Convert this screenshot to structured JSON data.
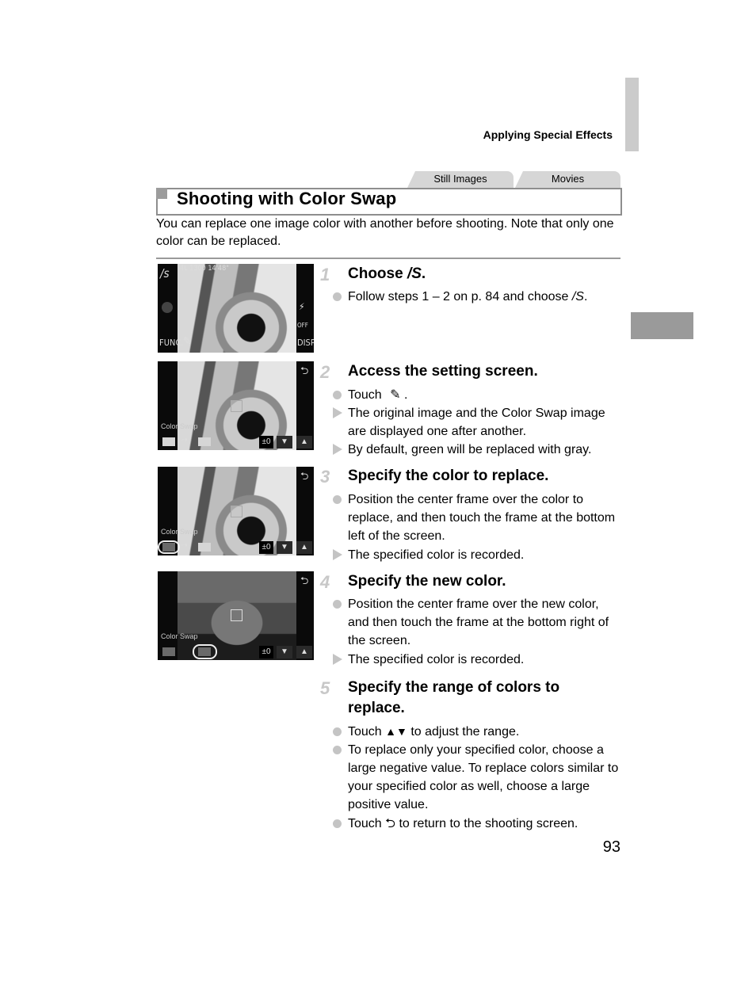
{
  "header": {
    "running_head": "Applying Special Effects",
    "tabs": [
      {
        "label": "Still Images"
      },
      {
        "label": "Movies"
      }
    ]
  },
  "section": {
    "title": "Shooting with Color Swap",
    "intro": "You can replace one image color with another before shooting. Note that only one color can be replaced."
  },
  "screens": [
    {
      "mode_icon": "/s",
      "status_text": "4L 1300 14'48\"",
      "left_buttons": [
        "●",
        "FUNC."
      ],
      "right_buttons": [
        "⚡",
        "OFF",
        "DISP."
      ],
      "eyedropper_icon": "eyedropper-icon"
    },
    {
      "label": "Color Swap",
      "range_value": "±0",
      "back_icon": "return-icon"
    },
    {
      "label": "Color Swap",
      "range_value": "±0",
      "highlight": "source-color-frame"
    },
    {
      "label": "Color Swap",
      "range_value": "±0",
      "highlight": "target-color-frame"
    }
  ],
  "steps": [
    {
      "number": "1",
      "title": "Choose",
      "title_icon": "/S",
      "bullets": [
        {
          "type": "action",
          "text": "Follow steps 1 – 2 on p. 84 and choose",
          "icon": "/S"
        }
      ]
    },
    {
      "number": "2",
      "title": "Access the setting screen.",
      "bullets": [
        {
          "type": "action",
          "text": "Touch",
          "icon": "eyedropper"
        },
        {
          "type": "result",
          "text": "The original image and the Color Swap image are displayed one after another."
        },
        {
          "type": "result",
          "text": "By default, green will be replaced with gray."
        }
      ]
    },
    {
      "number": "3",
      "title": "Specify the color to replace.",
      "bullets": [
        {
          "type": "action",
          "text": "Position the center frame over the color to replace, and then touch the frame at the bottom left of the screen."
        },
        {
          "type": "result",
          "text": "The specified color is recorded."
        }
      ]
    },
    {
      "number": "4",
      "title": "Specify the new color.",
      "bullets": [
        {
          "type": "action",
          "text": "Position the center frame over the new color, and then touch the frame at the bottom right of the screen."
        },
        {
          "type": "result",
          "text": "The specified color is recorded."
        }
      ]
    },
    {
      "number": "5",
      "title": "Specify the range of colors to replace.",
      "bullets": [
        {
          "type": "action",
          "text_before": "Touch",
          "icon": "▲▼",
          "text_after": "to adjust the range."
        },
        {
          "type": "action",
          "text": "To replace only your specified color, choose a large negative value. To replace colors similar to your specified color as well, choose a large positive value."
        },
        {
          "type": "action",
          "text_before": "Touch",
          "icon": "⮌",
          "text_after": "to return to the shooting screen."
        }
      ]
    }
  ],
  "page_number": "93"
}
